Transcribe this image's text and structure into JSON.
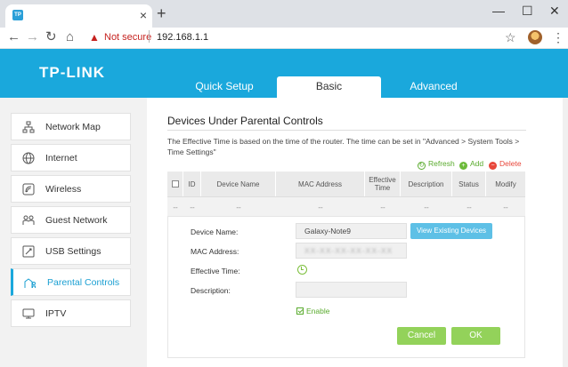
{
  "browser": {
    "tab_favicon": "TP",
    "tab_close": "×",
    "new_tab": "+",
    "window_controls": [
      "—",
      "☐",
      "✕"
    ],
    "back": "←",
    "forward": "→",
    "reload": "↻",
    "home": "⌂",
    "warning_icon": "▲",
    "not_secure": "Not secure",
    "url": "192.168.1.1",
    "star": "☆",
    "menu": "⋮"
  },
  "header": {
    "logo": "TP-LINK",
    "tabs": [
      {
        "label": "Quick Setup"
      },
      {
        "label": "Basic",
        "active": true
      },
      {
        "label": "Advanced"
      }
    ]
  },
  "sidebar": {
    "items": [
      {
        "label": "Network Map",
        "icon": "network-map-icon"
      },
      {
        "label": "Internet",
        "icon": "globe-icon"
      },
      {
        "label": "Wireless",
        "icon": "wireless-icon"
      },
      {
        "label": "Guest Network",
        "icon": "guest-network-icon"
      },
      {
        "label": "USB Settings",
        "icon": "usb-icon"
      },
      {
        "label": "Parental Controls",
        "icon": "parental-controls-icon",
        "active": true
      },
      {
        "label": "IPTV",
        "icon": "tv-icon"
      }
    ]
  },
  "main": {
    "title": "Devices Under Parental Controls",
    "description": "The Effective Time is based on the time of the router. The time can be set in \"Advanced > System Tools > Time Settings\"",
    "actions": {
      "refresh": "Refresh",
      "add": "Add",
      "delete": "Delete"
    },
    "table": {
      "columns": [
        "ID",
        "Device Name",
        "MAC Address",
        "Effective Time",
        "Description",
        "Status",
        "Modify"
      ],
      "row": [
        "--",
        "--",
        "--",
        "--",
        "--",
        "--",
        "--",
        "--"
      ]
    },
    "form": {
      "device_name_label": "Device Name:",
      "device_name_value": "Galaxy-Note9",
      "view_devices_button": "View Existing Devices",
      "mac_label": "MAC Address:",
      "mac_value": "XX-XX-XX-XX-XX-XX",
      "effective_time_label": "Effective Time:",
      "description_label": "Description:",
      "description_value": "",
      "enable_label": "Enable",
      "cancel_button": "Cancel",
      "ok_button": "OK"
    }
  },
  "colors": {
    "brand": "#1aa8dc",
    "green": "#93d25a",
    "delete_red": "#e8473b"
  }
}
